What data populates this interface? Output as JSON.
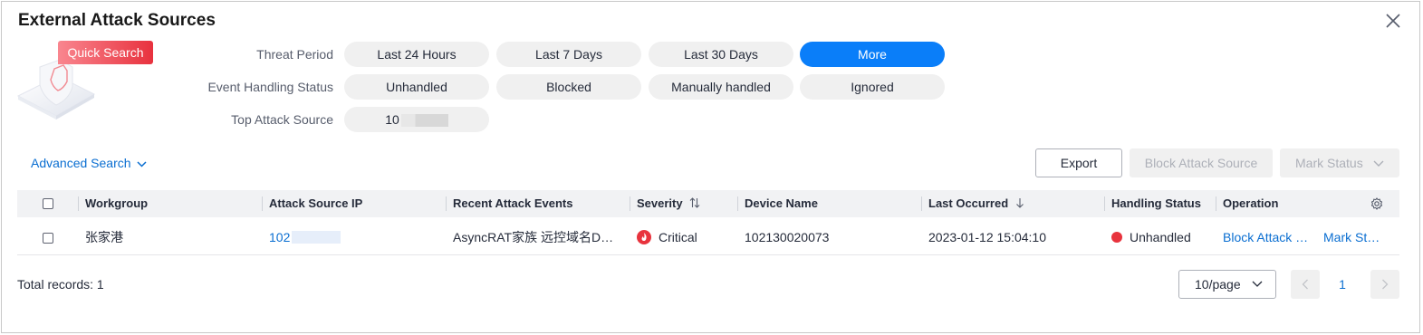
{
  "dialog": {
    "title": "External Attack Sources"
  },
  "quick_search": {
    "badge": "Quick Search",
    "rows": [
      {
        "label": "Threat Period",
        "options": [
          "Last 24 Hours",
          "Last 7 Days",
          "Last 30 Days",
          "More"
        ],
        "selected": "More"
      },
      {
        "label": "Event Handling Status",
        "options": [
          "Unhandled",
          "Blocked",
          "Manually handled",
          "Ignored"
        ]
      },
      {
        "label": "Top Attack Source",
        "options": [
          "10"
        ]
      }
    ]
  },
  "toolbar": {
    "advanced_search": "Advanced Search",
    "export": "Export",
    "block_attack_source": "Block Attack Source",
    "mark_status": "Mark Status"
  },
  "table": {
    "columns": {
      "workgroup": "Workgroup",
      "attack_source_ip": "Attack Source IP",
      "recent_attack_events": "Recent Attack Events",
      "severity": "Severity",
      "device_name": "Device Name",
      "last_occurred": "Last Occurred",
      "handling_status": "Handling Status",
      "operation": "Operation"
    },
    "rows": [
      {
        "workgroup": "张家港",
        "attack_source_ip": "102",
        "recent_attack_events": "AsyncRAT家族 远控域名D…",
        "severity": "Critical",
        "device_name": "102130020073",
        "last_occurred": "2023-01-12 15:04:10",
        "handling_status": "Unhandled",
        "op_block": "Block Attack …",
        "op_mark": "Mark St…"
      }
    ]
  },
  "footer": {
    "total_records": "Total records: 1",
    "page_size": "10/page",
    "current_page": "1"
  },
  "colors": {
    "accent": "#0a7ef9",
    "link": "#0a6ed1",
    "critical": "#e8333d",
    "badge": "#e8323e"
  }
}
